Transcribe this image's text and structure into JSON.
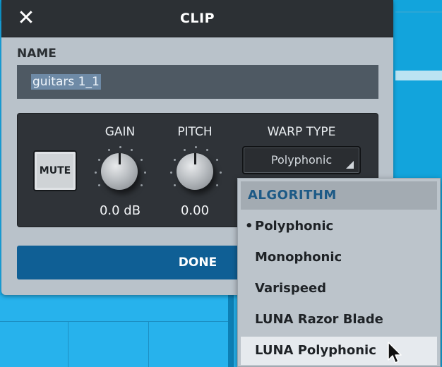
{
  "dialog": {
    "title": "CLIP",
    "close_icon": "close-icon",
    "name_label": "NAME",
    "name_value": "guitars 1_1",
    "mute_label": "MUTE",
    "gain": {
      "label": "GAIN",
      "value": "0.0 dB"
    },
    "pitch": {
      "label": "PITCH",
      "value": "0.00"
    },
    "warp": {
      "label": "WARP TYPE",
      "selected": "Polyphonic"
    },
    "done_label": "DONE"
  },
  "dropdown": {
    "header": "ALGORITHM",
    "items": [
      {
        "label": "Polyphonic",
        "bullet": "•",
        "selected": true
      },
      {
        "label": "Monophonic"
      },
      {
        "label": "Varispeed"
      },
      {
        "label": "LUNA Razor Blade"
      },
      {
        "label": "LUNA Polyphonic",
        "hovered": true
      }
    ]
  },
  "colors": {
    "accent_blue": "#0f5f95",
    "dialog_bg": "#b9c2ca",
    "titlebar_bg": "#2c3034",
    "daw_bg": "#1badea"
  }
}
